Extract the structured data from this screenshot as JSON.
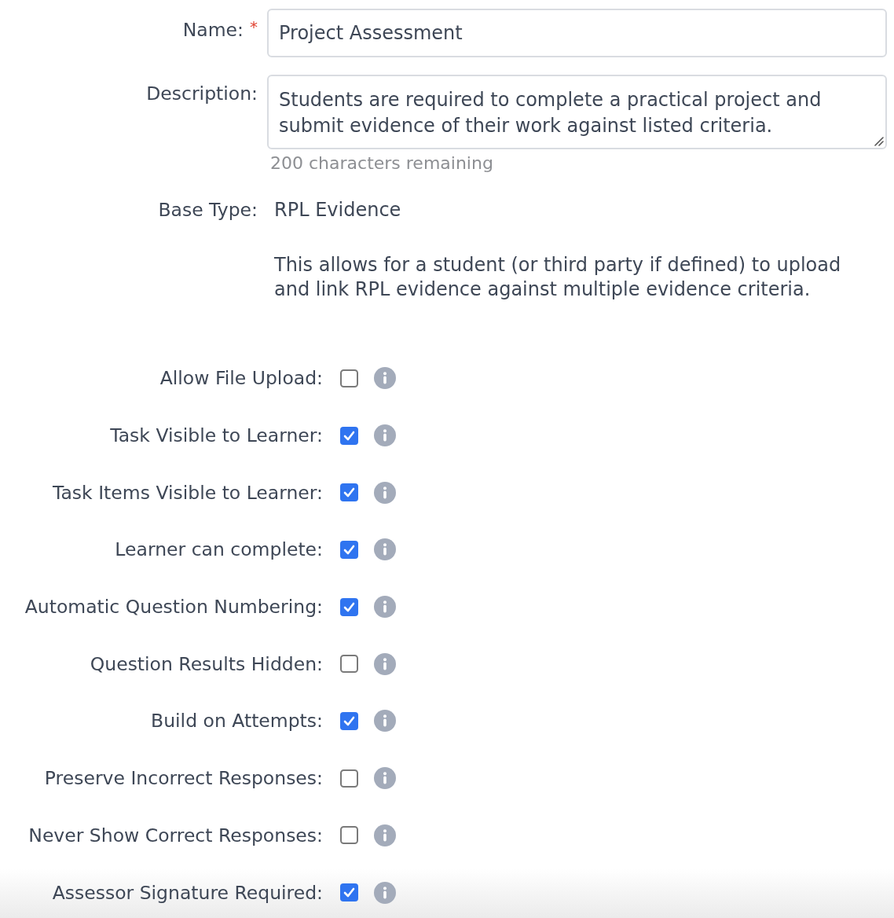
{
  "name_field": {
    "label": "Name:",
    "required_mark": "*",
    "value": "Project Assessment"
  },
  "description_field": {
    "label": "Description:",
    "value": "Students are required to complete a practical project and submit evidence of their work against listed criteria.",
    "hint": "200 characters remaining"
  },
  "base_type": {
    "label": "Base Type:",
    "value": "RPL Evidence",
    "description": "This allows for a student (or third party if defined) to upload and link RPL evidence against multiple evidence criteria."
  },
  "options": [
    {
      "label": "Allow File Upload:",
      "checked": false
    },
    {
      "label": "Task Visible to Learner:",
      "checked": true
    },
    {
      "label": "Task Items Visible to Learner:",
      "checked": true
    },
    {
      "label": "Learner can complete:",
      "checked": true
    },
    {
      "label": "Automatic Question Numbering:",
      "checked": true
    },
    {
      "label": "Question Results Hidden:",
      "checked": false
    },
    {
      "label": "Build on Attempts:",
      "checked": true
    },
    {
      "label": "Preserve Incorrect Responses:",
      "checked": false
    },
    {
      "label": "Never Show Correct Responses:",
      "checked": false
    },
    {
      "label": "Assessor Signature Required:",
      "checked": true
    }
  ]
}
